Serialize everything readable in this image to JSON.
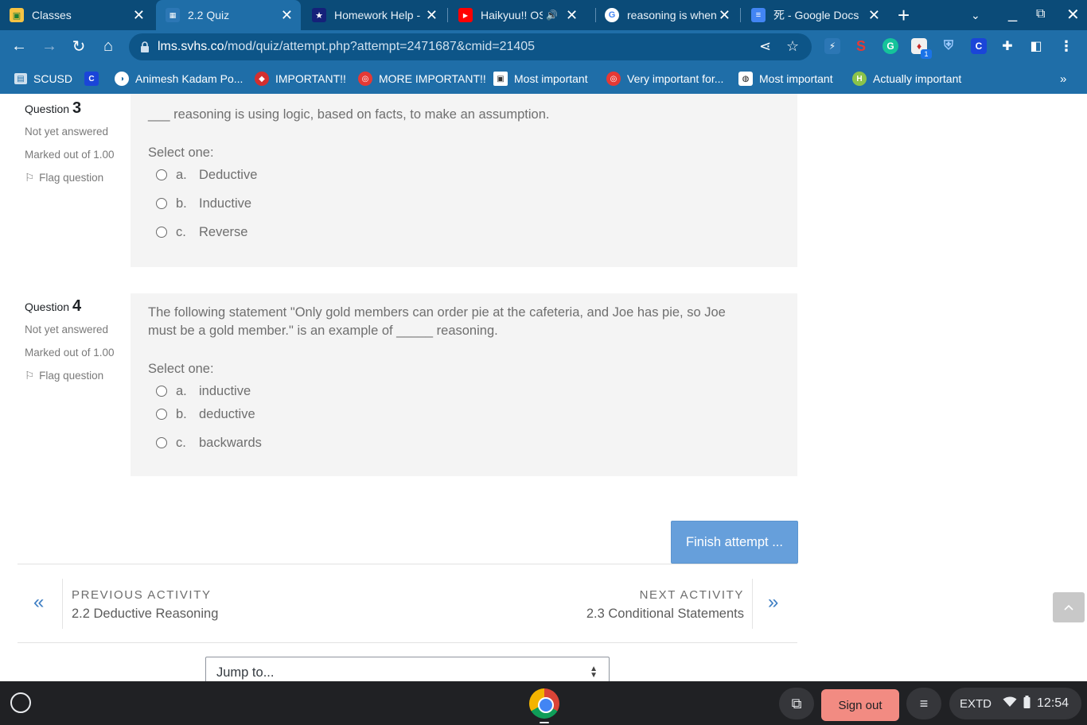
{
  "tabs": [
    {
      "title": "Classes",
      "icon": "google-classroom-icon"
    },
    {
      "title": "2.2 Quiz",
      "icon": "moodle-site-icon"
    },
    {
      "title": "Homework Help - ",
      "icon": "star-icon"
    },
    {
      "title": "Haikyuu!! OST",
      "icon": "youtube-icon"
    },
    {
      "title": "reasoning is when",
      "icon": "google-icon"
    },
    {
      "title": "死 - Google Docs",
      "icon": "google-docs-icon"
    }
  ],
  "address_bar": {
    "host": "lms.svhs.co",
    "path": "/mod/quiz/attempt.php?attempt=2471687&cmid=21405"
  },
  "extensions": {
    "badge_count": "1"
  },
  "bookmarks": [
    {
      "label": "SCUSD",
      "icon": "folder-icon"
    },
    {
      "label": "",
      "icon": "c-icon"
    },
    {
      "label": "Animesh Kadam Po...",
      "icon": "globe-icon"
    },
    {
      "label": "IMPORTANT!!",
      "icon": "mask-icon"
    },
    {
      "label": "MORE IMPORTANT!!",
      "icon": "basketball-icon"
    },
    {
      "label": "Most important",
      "icon": "bookmark-icon"
    },
    {
      "label": "Very important for...",
      "icon": "basketball-icon"
    },
    {
      "label": "Most important",
      "icon": "volleyball-icon"
    },
    {
      "label": "Actually important",
      "icon": "bookmark-icon"
    }
  ],
  "bookmarks_more": "»",
  "questions": [
    {
      "label": "Question",
      "number": "3",
      "state": "Not yet answered",
      "marked": "Marked out of 1.00",
      "flag": "Flag question",
      "text": "___ reasoning is using logic, based on facts, to make an assumption.",
      "select_one": "Select one:",
      "options": [
        {
          "letter": "a.",
          "text": "Deductive"
        },
        {
          "letter": "b.",
          "text": "Inductive"
        },
        {
          "letter": "c.",
          "text": "Reverse"
        }
      ]
    },
    {
      "label": "Question",
      "number": "4",
      "state": "Not yet answered",
      "marked": "Marked out of 1.00",
      "flag": "Flag question",
      "text_line1": "The following statement \"Only gold members can order pie at the cafeteria, and Joe has pie, so Joe",
      "text_line2": "must be a gold member.\"  is an example of _____ reasoning.",
      "select_one": "Select one:",
      "options": [
        {
          "letter": "a.",
          "text": "inductive"
        },
        {
          "letter": "b.",
          "text": "deductive"
        },
        {
          "letter": "c.",
          "text": "backwards"
        }
      ]
    }
  ],
  "finish_button": "Finish attempt ...",
  "activity_nav": {
    "prev_label": "PREVIOUS ACTIVITY",
    "prev_title": "2.2 Deductive Reasoning",
    "next_label": "NEXT ACTIVITY",
    "next_title": "2.3 Conditional Statements",
    "prev_chevron": "«",
    "next_chevron": "»"
  },
  "jump_to": {
    "selected": "Jump to..."
  },
  "shelf": {
    "sign_out": "Sign out",
    "input_method": "EXTD",
    "time": "12:54"
  }
}
